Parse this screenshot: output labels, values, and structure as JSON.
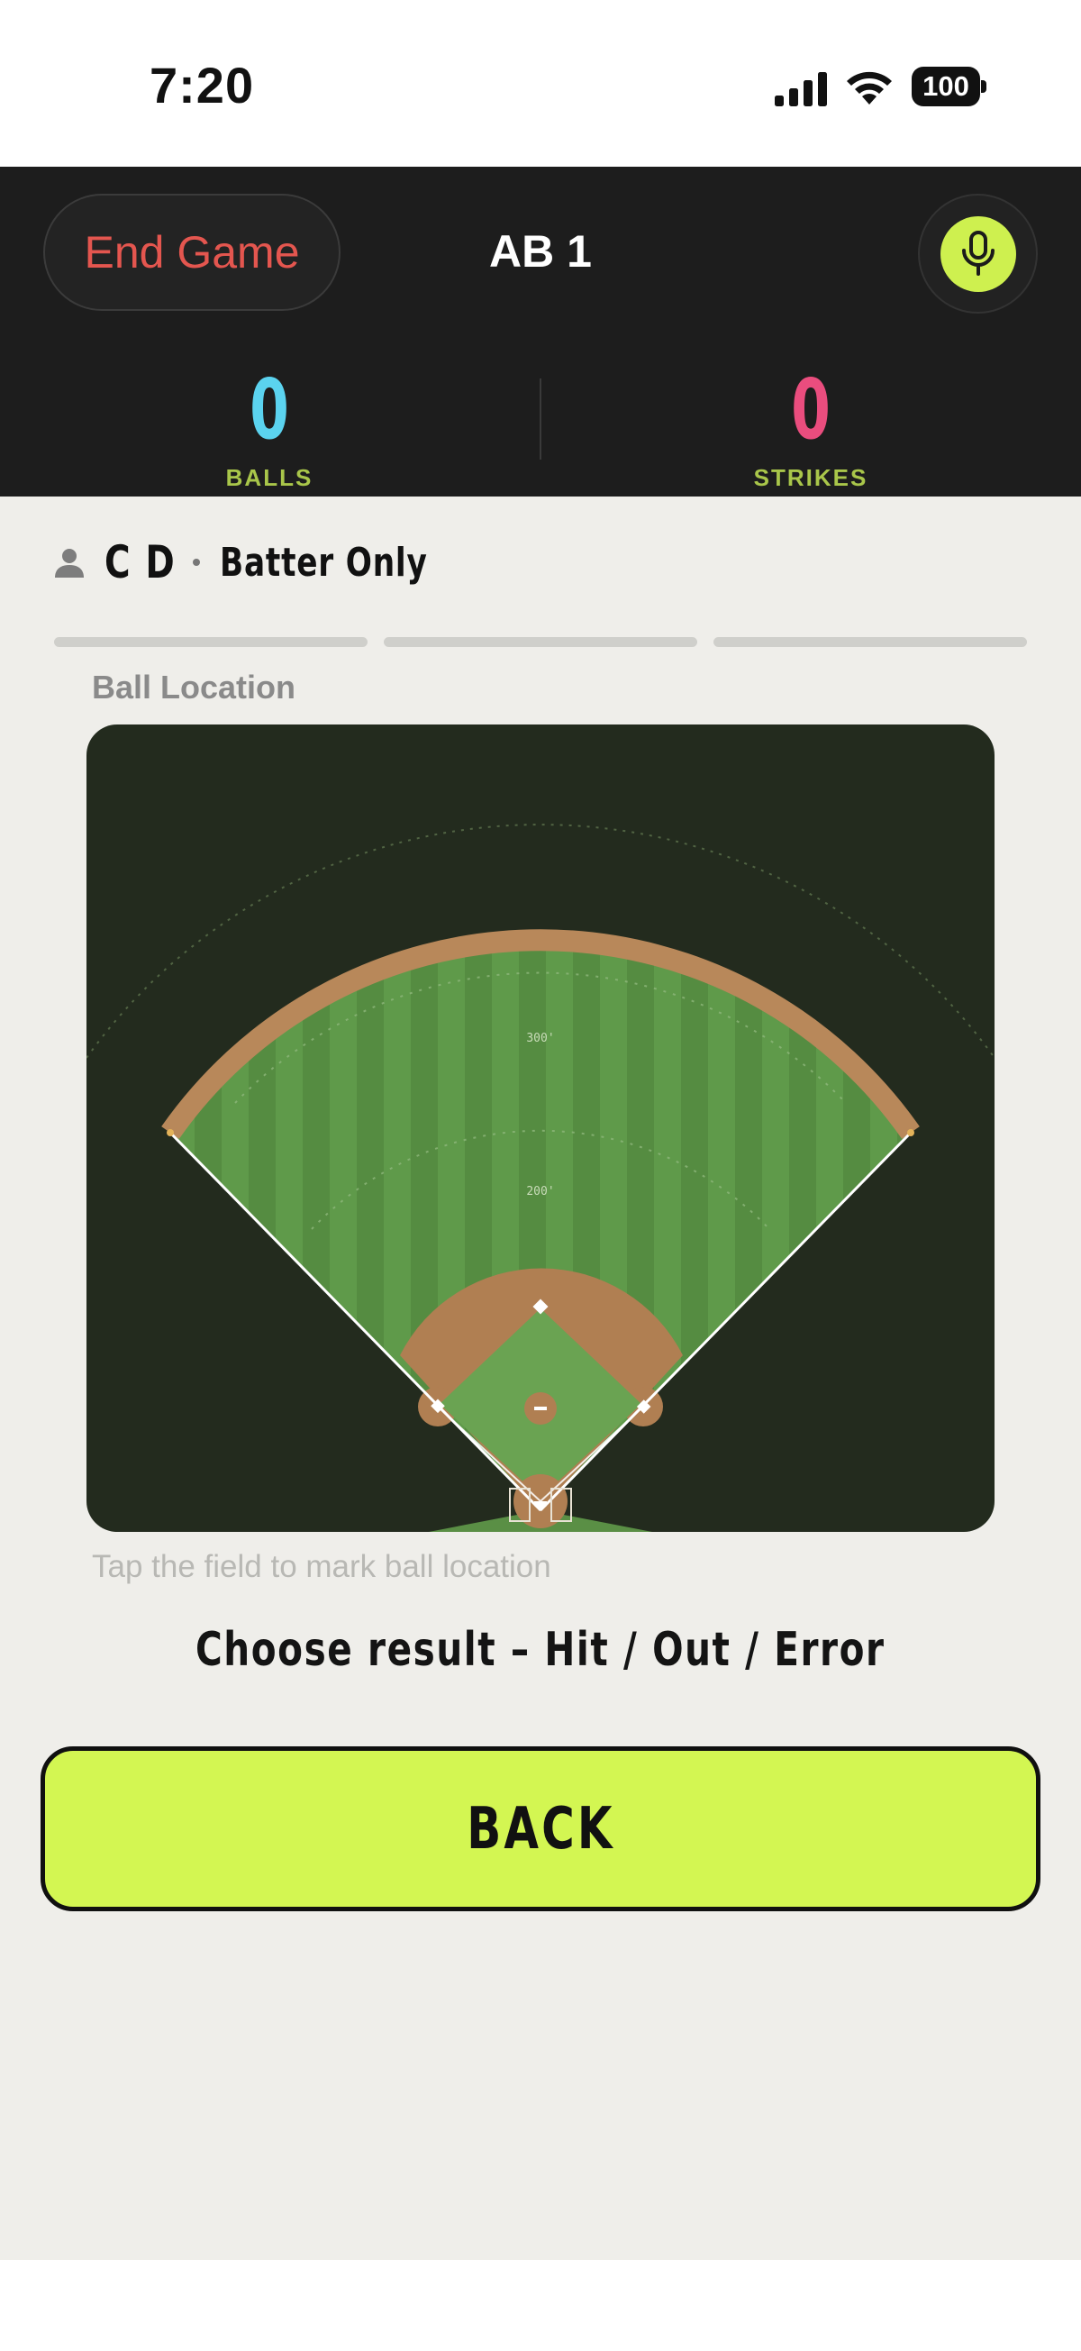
{
  "status_bar": {
    "time": "7:20",
    "battery": "100"
  },
  "header": {
    "end_game_label": "End Game",
    "title": "AB 1",
    "balls": {
      "value": "0",
      "label": "BALLS",
      "color": "#5bd3ef"
    },
    "strikes": {
      "value": "0",
      "label": "STRIKES",
      "color": "#ea4d7e"
    }
  },
  "batter": {
    "name": "C D",
    "mode": "Batter Only"
  },
  "progress": {
    "total_steps": 3
  },
  "field": {
    "label": "Ball Location",
    "distance_markers": [
      "300'",
      "200'"
    ],
    "hint": "Tap the field to mark ball location"
  },
  "prompt": "Choose result – Hit / Out / Error",
  "back_button": "BACK",
  "colors": {
    "accent": "#d3f652",
    "header_bg": "#1d1d1d",
    "danger": "#e4564f",
    "grass": "#5f9a4a",
    "dirt": "#b07f52"
  },
  "icons": [
    "signal-icon",
    "wifi-icon",
    "battery-icon",
    "microphone-icon",
    "person-icon"
  ]
}
